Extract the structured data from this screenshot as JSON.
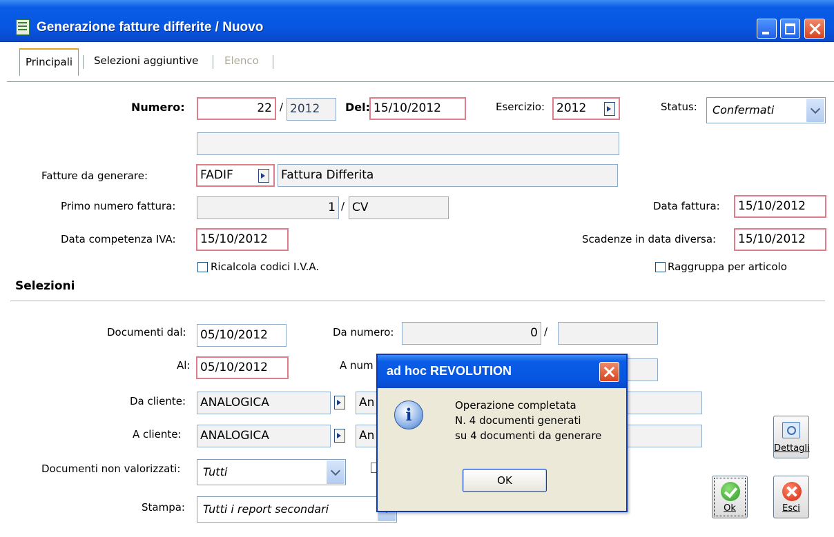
{
  "window": {
    "title": "Generazione fatture differite / Nuovo"
  },
  "tabs": [
    "Principali",
    "Selezioni aggiuntive",
    "Elenco"
  ],
  "header": {
    "numero_label": "Numero:",
    "numero": "22",
    "serie": "2012",
    "del_label": "Del:",
    "del": "15/10/2012",
    "esercizio_label": "Esercizio:",
    "esercizio": "2012",
    "status_label": "Status:",
    "status": "Confermati"
  },
  "main": {
    "fatture_label": "Fatture da generare:",
    "fatture_code": "FADIF",
    "fatture_desc": "Fattura Differita",
    "primo_label": "Primo numero fattura:",
    "primo_num": "1",
    "primo_serie": "CV",
    "data_fattura_label": "Data fattura:",
    "data_fattura": "15/10/2012",
    "data_iva_label": "Data competenza IVA:",
    "data_iva": "15/10/2012",
    "scadenze_label": "Scadenze in data diversa:",
    "scadenze": "15/10/2012",
    "ricalcola_label": "Ricalcola codici I.V.A.",
    "raggruppa_label": "Raggruppa per articolo"
  },
  "selezioni": {
    "title": "Selezioni",
    "doc_dal_label": "Documenti dal:",
    "doc_dal": "05/10/2012",
    "al_label": "Al:",
    "al": "05/10/2012",
    "da_numero_label": "Da numero:",
    "da_numero": "0",
    "a_numero_label": "A num",
    "da_cliente_label": "Da cliente:",
    "da_cliente": "ANALOGICA",
    "da_cliente_desc": "An",
    "a_cliente_label": "A cliente:",
    "a_cliente": "ANALOGICA",
    "a_cliente_desc": "An",
    "non_valorizzati_label": "Documenti non valorizzati:",
    "non_valorizzati": "Tutti",
    "stampa_label": "Stampa:",
    "stampa": "Tutti i report secondari"
  },
  "buttons": {
    "dettagli": "Dettagli",
    "ok": "Ok",
    "esci": "Esci"
  },
  "dialog": {
    "title": "ad hoc REVOLUTION",
    "line1": "Operazione completata",
    "line2": "N. 4 documenti generati",
    "line3": "su 4 documenti da generare",
    "ok": "OK"
  }
}
